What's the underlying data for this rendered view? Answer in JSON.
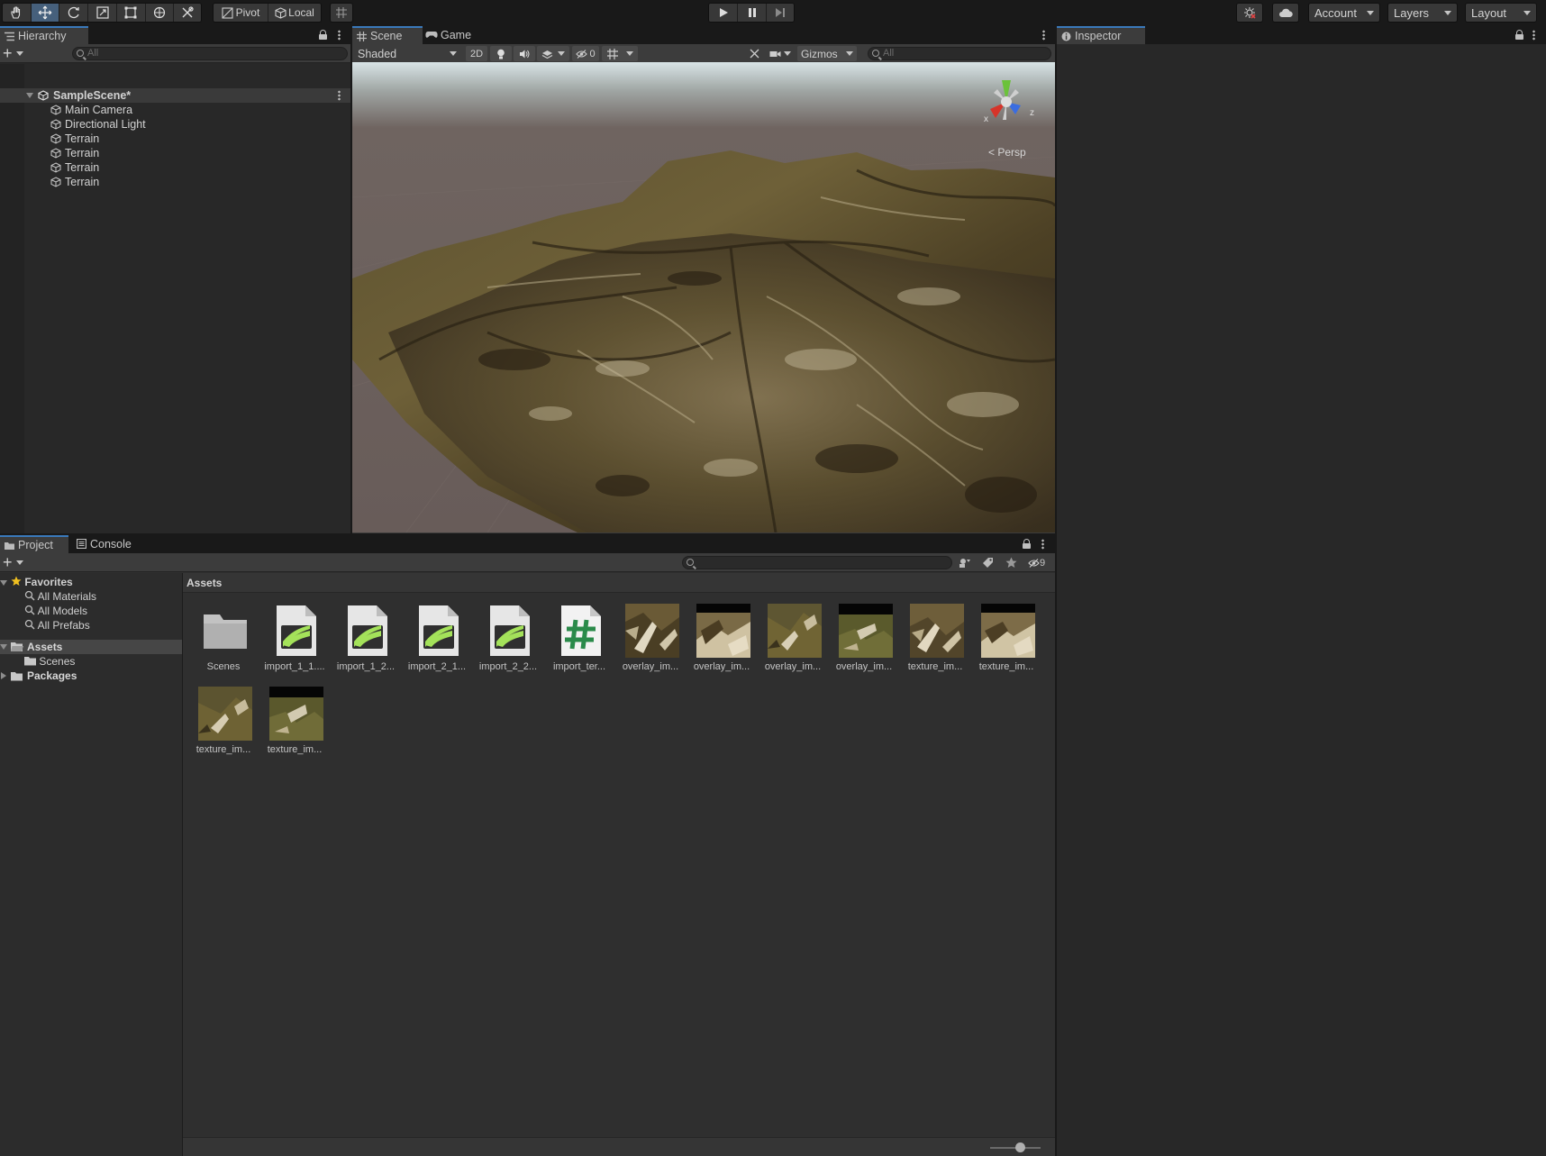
{
  "toolbar": {
    "pivot_label": "Pivot",
    "local_label": "Local",
    "account_label": "Account",
    "layers_label": "Layers",
    "layout_label": "Layout"
  },
  "hierarchy": {
    "tab_label": "Hierarchy",
    "search_placeholder": "All",
    "scene_name": "SampleScene*",
    "items": [
      {
        "label": "Main Camera"
      },
      {
        "label": "Directional Light"
      },
      {
        "label": "Terrain"
      },
      {
        "label": "Terrain"
      },
      {
        "label": "Terrain"
      },
      {
        "label": "Terrain"
      }
    ]
  },
  "scene": {
    "tab_scene": "Scene",
    "tab_game": "Game",
    "shading_mode": "Shaded",
    "mode_2d": "2D",
    "hidden_count": "0",
    "gizmos_label": "Gizmos",
    "search_placeholder": "All",
    "persp_label": "Persp",
    "axis_x": "x",
    "axis_z": "z"
  },
  "inspector": {
    "tab_label": "Inspector"
  },
  "project": {
    "tab_project": "Project",
    "tab_console": "Console",
    "hidden_count": "9",
    "favorites_label": "Favorites",
    "favorites": [
      "All Materials",
      "All Models",
      "All Prefabs"
    ],
    "assets_label": "Assets",
    "assets_children": [
      "Scenes"
    ],
    "packages_label": "Packages",
    "breadcrumb": "Assets",
    "assets": [
      {
        "name": "Scenes",
        "kind": "folder"
      },
      {
        "name": "import_1_1....",
        "kind": "terrain-data"
      },
      {
        "name": "import_1_2...",
        "kind": "terrain-data"
      },
      {
        "name": "import_2_1...",
        "kind": "terrain-data"
      },
      {
        "name": "import_2_2...",
        "kind": "terrain-data"
      },
      {
        "name": "import_ter...",
        "kind": "script"
      },
      {
        "name": "overlay_im...",
        "kind": "texture"
      },
      {
        "name": "overlay_im...",
        "kind": "texture"
      },
      {
        "name": "overlay_im...",
        "kind": "texture"
      },
      {
        "name": "overlay_im...",
        "kind": "texture"
      },
      {
        "name": "texture_im...",
        "kind": "texture"
      },
      {
        "name": "texture_im...",
        "kind": "texture"
      },
      {
        "name": "texture_im...",
        "kind": "texture"
      },
      {
        "name": "texture_im...",
        "kind": "texture"
      }
    ]
  },
  "colors": {
    "accent": "#3a79bb",
    "panel_bg": "#282828",
    "terrain_icon": "#a4e25a",
    "script_icon": "#2a8a4a"
  }
}
